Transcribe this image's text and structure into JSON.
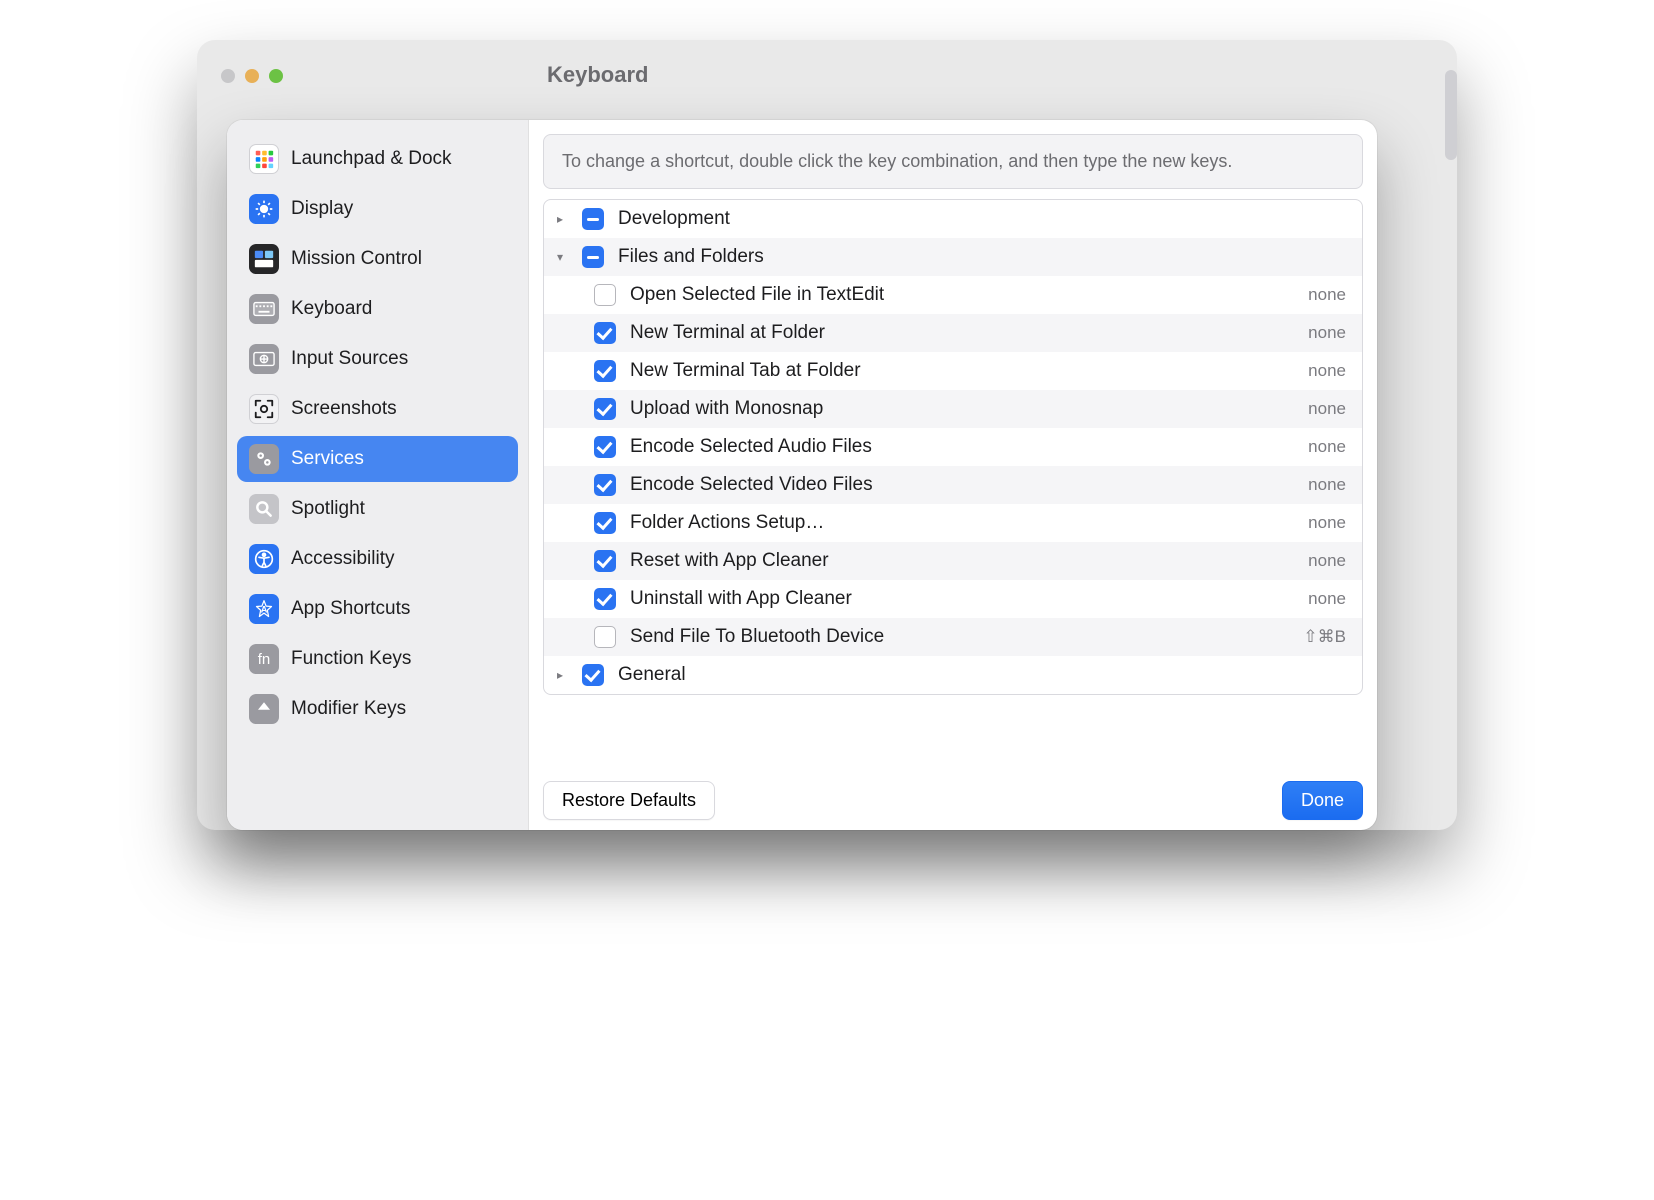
{
  "window_title": "Keyboard",
  "sidebar": {
    "items": [
      {
        "label": "Launchpad & Dock",
        "icon": "launchpad",
        "bg": "#ffffff"
      },
      {
        "label": "Display",
        "icon": "display",
        "bg": "#2a73f2"
      },
      {
        "label": "Mission Control",
        "icon": "mission",
        "bg": "#262628"
      },
      {
        "label": "Keyboard",
        "icon": "keyboard",
        "bg": "#9a9aa0"
      },
      {
        "label": "Input Sources",
        "icon": "input",
        "bg": "#9a9aa0"
      },
      {
        "label": "Screenshots",
        "icon": "screenshot",
        "bg": "#f2f2f4"
      },
      {
        "label": "Services",
        "icon": "services",
        "bg": "#9a9aa0",
        "selected": true
      },
      {
        "label": "Spotlight",
        "icon": "spotlight",
        "bg": "#c4c4c8"
      },
      {
        "label": "Accessibility",
        "icon": "accessibility",
        "bg": "#2a73f2"
      },
      {
        "label": "App Shortcuts",
        "icon": "appshort",
        "bg": "#2a73f2"
      },
      {
        "label": "Function Keys",
        "icon": "fn",
        "bg": "#9a9aa0"
      },
      {
        "label": "Modifier Keys",
        "icon": "modifier",
        "bg": "#9a9aa0"
      }
    ]
  },
  "help_text": "To change a shortcut, double click the key combination, and then type the new keys.",
  "categories": [
    {
      "label": "Development",
      "state": "mixed",
      "expanded": false
    },
    {
      "label": "Files and Folders",
      "state": "mixed",
      "expanded": true,
      "children": [
        {
          "label": "Open Selected File in TextEdit",
          "checked": false,
          "shortcut": "none"
        },
        {
          "label": "New Terminal at Folder",
          "checked": true,
          "shortcut": "none"
        },
        {
          "label": "New Terminal Tab at Folder",
          "checked": true,
          "shortcut": "none"
        },
        {
          "label": "Upload with Monosnap",
          "checked": true,
          "shortcut": "none"
        },
        {
          "label": "Encode Selected Audio Files",
          "checked": true,
          "shortcut": "none"
        },
        {
          "label": "Encode Selected Video Files",
          "checked": true,
          "shortcut": "none"
        },
        {
          "label": "Folder Actions Setup…",
          "checked": true,
          "shortcut": "none"
        },
        {
          "label": "Reset with App Cleaner",
          "checked": true,
          "shortcut": "none"
        },
        {
          "label": "Uninstall with App Cleaner",
          "checked": true,
          "shortcut": "none"
        },
        {
          "label": "Send File To Bluetooth Device",
          "checked": false,
          "shortcut": "⇧⌘B"
        }
      ]
    },
    {
      "label": "General",
      "state": "on",
      "expanded": false
    }
  ],
  "buttons": {
    "restore": "Restore Defaults",
    "done": "Done"
  },
  "traffic_colors": {
    "close": "#c7c7c9",
    "min": "#e8b057",
    "max": "#6cc244"
  }
}
